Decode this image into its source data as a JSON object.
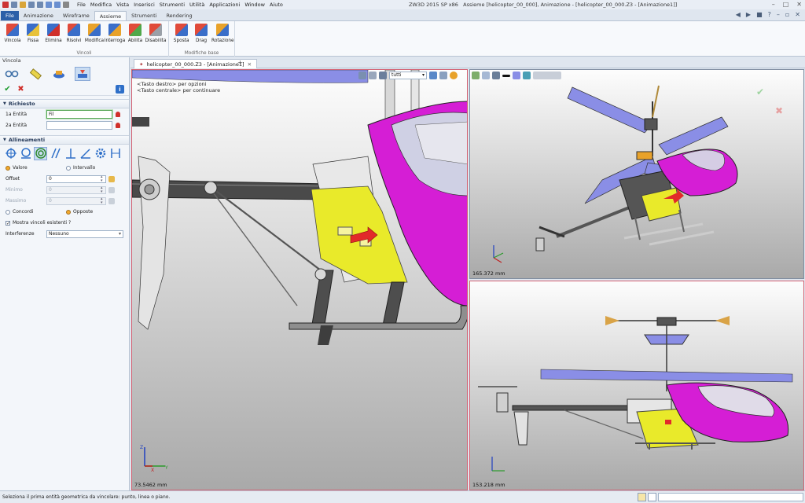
{
  "app": {
    "title": "ZW3D 2015 SP x86",
    "document": "Assieme [helicopter_00_000],  Animazione - [helicopter_00_000.Z3 - [Animazione1]]"
  },
  "menu": [
    "File",
    "Modifica",
    "Vista",
    "Inserisci",
    "Strumenti",
    "Utilità",
    "Applicazioni",
    "Window",
    "Aiuto"
  ],
  "ribbon_tabs": [
    "File",
    "Animazione",
    "Wireframe",
    "Assieme",
    "Strumenti",
    "Rendering"
  ],
  "ribbon_active": "Assieme",
  "ribbon_groups": [
    {
      "label": "Vincoli",
      "buttons": [
        "Vincola",
        "Fissa",
        "Elimina",
        "Risolvi",
        "Modifica",
        "Interroga",
        "Abilita",
        "Disabilita"
      ]
    },
    {
      "label": "Modifiche base",
      "buttons": [
        "Sposta",
        "Drag",
        "Rotazione"
      ]
    }
  ],
  "panel": {
    "title": "Vincola",
    "section_required": "Richiesto",
    "field1_label": "1a Entità",
    "field1_value": "Fil",
    "field2_label": "2a Entità",
    "field2_value": "",
    "section_align": "Allineamenti",
    "radio_value": "Valore",
    "radio_interval": "Intervallo",
    "offset_label": "Offset",
    "offset_value": "0",
    "min_label": "Minimo",
    "min_value": "0",
    "max_label": "Massimo",
    "max_value": "0",
    "radio_concordi": "Concordi",
    "radio_opposte": "Opposte",
    "show_existing": "Mostra vincoli esistenti ?",
    "interference_label": "Interferenze",
    "interference_value": "Nessuno"
  },
  "doc_tab": "helicopter_00_000.Z3 - [Animazione1]",
  "viewport_main": {
    "hint1": "<Tasto destro> per opzioni",
    "hint2": "<Tasto centrale> per continuare",
    "filter": "tutti",
    "scale": "73.5462 mm"
  },
  "viewport_ur": {
    "scale": "165.372 mm"
  },
  "viewport_lr": {
    "scale": "153.218 mm"
  },
  "status": "Seleziona il prima entità geometrica da vincolare: punto, linea o piano.",
  "colors": {
    "body_magenta": "#d51ed5",
    "blade_blue": "#8a8ee6",
    "plate_yellow": "#e9ea2a",
    "accent_blue": "#2b5fa8"
  }
}
